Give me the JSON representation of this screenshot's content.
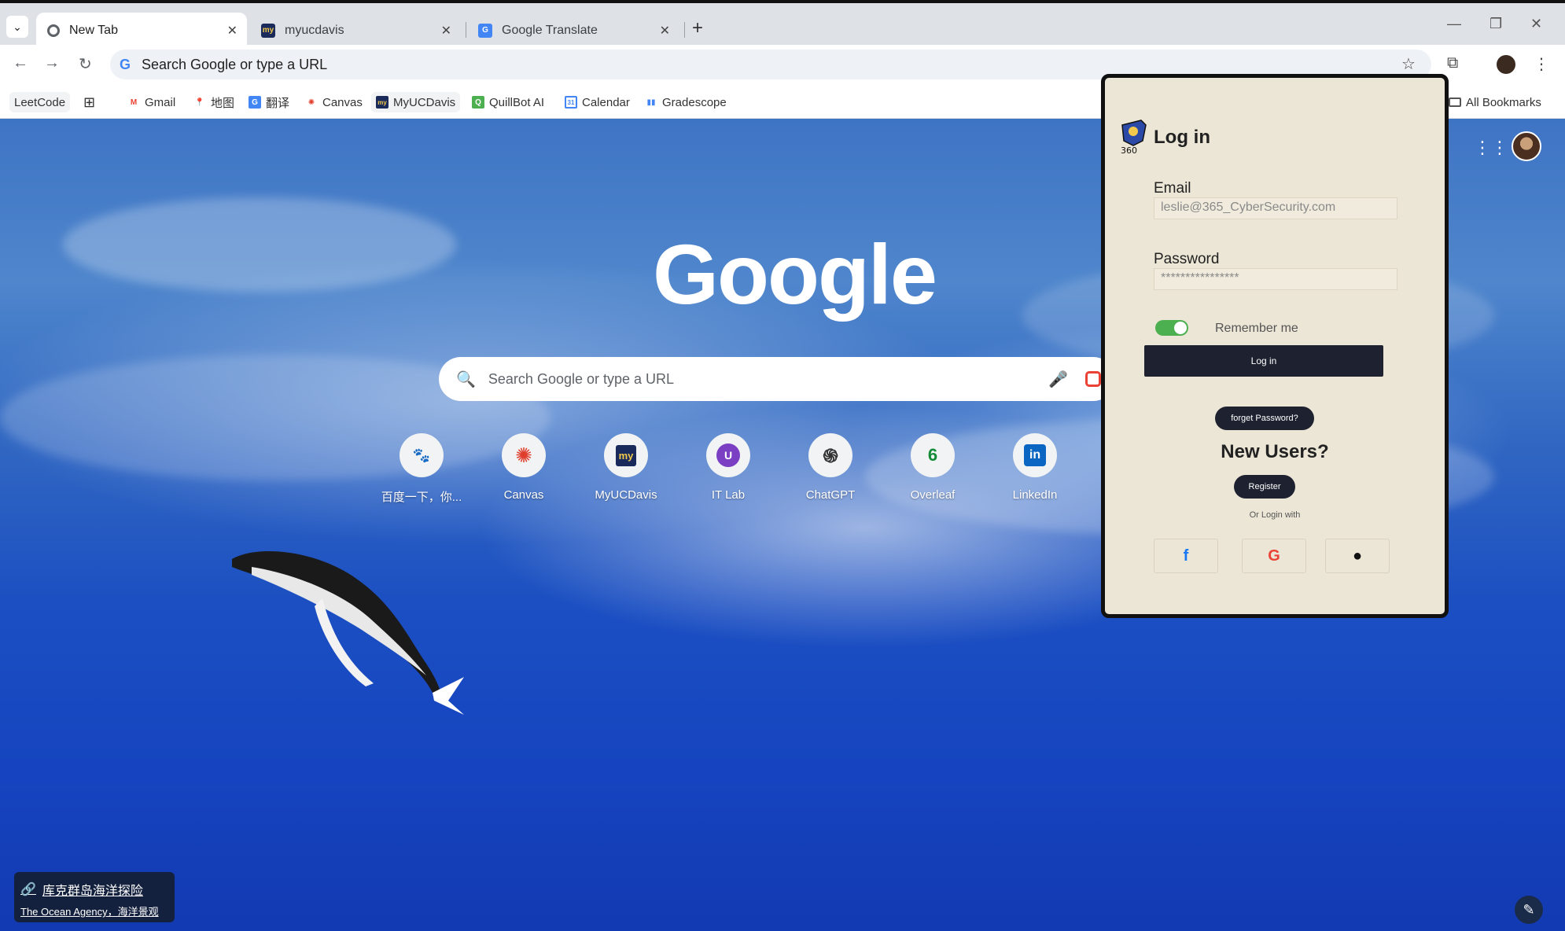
{
  "tabs": [
    {
      "title": "New Tab",
      "active": true
    },
    {
      "title": "myucdavis",
      "active": false
    },
    {
      "title": "Google Translate",
      "active": false
    }
  ],
  "omnibox": {
    "placeholder": "Search Google or type a URL"
  },
  "bookmarks": [
    {
      "label": "LeetCode"
    },
    {
      "label": "Gmail"
    },
    {
      "label": "地图"
    },
    {
      "label": "翻译"
    },
    {
      "label": "Canvas"
    },
    {
      "label": "MyUCDavis"
    },
    {
      "label": "QuillBot AI"
    },
    {
      "label": "Calendar"
    },
    {
      "label": "Gradescope"
    },
    {
      "label": "All Bookmarks"
    }
  ],
  "ntp": {
    "logo_text": "Google",
    "search_placeholder": "Search Google or type a URL",
    "shortcuts": [
      {
        "label": "百度一下，你...",
        "glyph": "🐾"
      },
      {
        "label": "Canvas",
        "glyph": "✺"
      },
      {
        "label": "MyUCDavis",
        "glyph": "my"
      },
      {
        "label": "IT Lab",
        "glyph": "U"
      },
      {
        "label": "ChatGPT",
        "glyph": "֍"
      },
      {
        "label": "Overleaf",
        "glyph": "6"
      },
      {
        "label": "LinkedIn",
        "glyph": "in"
      }
    ],
    "credit": {
      "line1": "库克群岛海洋探险",
      "line2": "The Ocean Agency，海洋景观"
    }
  },
  "login": {
    "logo_text": "360",
    "title": "Log in",
    "email_label": "Email",
    "email_value": "leslie@365_CyberSecurity.com",
    "password_label": "Password",
    "password_value": "****************",
    "remember_label": "Remember me",
    "login_button": "Log in",
    "forgot_button": "forget Password?",
    "new_users": "New Users?",
    "register_button": "Register",
    "or_login_with": "Or Login with"
  },
  "colors": {
    "panel_bg": "#ece6d6",
    "button_dark": "#1e2230",
    "toggle_on": "#4caf50"
  }
}
